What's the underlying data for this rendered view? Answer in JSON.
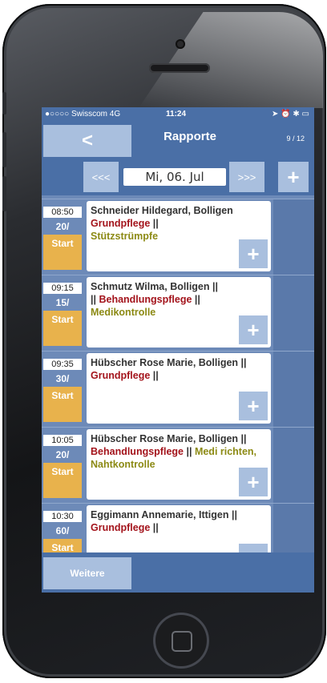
{
  "statusbar": {
    "carrier": "●○○○○ Swisscom  4G",
    "time": "11:24",
    "indicators": "➤ ⏰ ✱ ▭"
  },
  "nav": {
    "back_label": "<",
    "title": "Rapporte",
    "page_counter": "9 / 12"
  },
  "datebar": {
    "prev_label": "<<<",
    "date": "Mi, 06. Jul",
    "next_label": ">>>",
    "add_label": "+"
  },
  "appointments": [
    {
      "time": "08:50",
      "duration": "20/",
      "start_label": "Start",
      "name": "Schneider Hildegard, Bolligen",
      "service": "Grundpflege",
      "sep": " ||",
      "detail": "Stützstrümpfe",
      "plus": "+"
    },
    {
      "time": "09:15",
      "duration": "15/",
      "start_label": "Start",
      "name": "Schmutz Wilma, Bolligen ||",
      "pre": "|| ",
      "service": "Behandlungspflege",
      "sep": " ||",
      "detail": "Medikontrolle",
      "plus": "+"
    },
    {
      "time": "09:35",
      "duration": "30/",
      "start_label": "Start",
      "name": "Hübscher Rose Marie, Bolligen ||",
      "service": "Grundpflege",
      "sep": " ||",
      "detail": "",
      "plus": "+"
    },
    {
      "time": "10:05",
      "duration": "20/",
      "start_label": "Start",
      "name": "Hübscher Rose Marie, Bolligen ||",
      "service": "Behandlungspflege",
      "sep": " || ",
      "detail": "Medi richten, Nahtkontrolle",
      "plus": "+"
    },
    {
      "time": "10:30",
      "duration": "60/",
      "start_label": "Start",
      "name": "Eggimann Annemarie, Ittigen ||",
      "service": "Grundpflege",
      "sep": " ||",
      "detail": "",
      "plus": "+"
    }
  ],
  "footer": {
    "more_label": "Weitere"
  },
  "colors": {
    "bar": "#4a6fa6",
    "button": "#a9bfde",
    "start": "#e8b24c",
    "service": "#a3131b",
    "detail": "#8c8a14"
  }
}
